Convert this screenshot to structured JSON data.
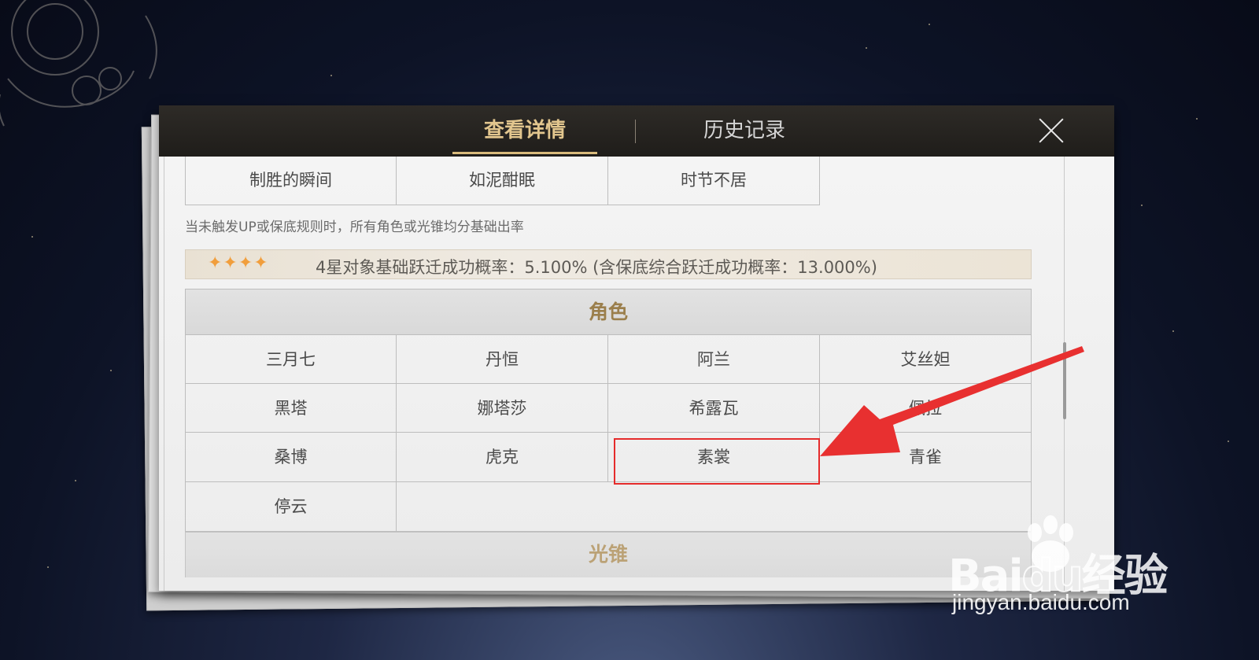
{
  "tabs": [
    {
      "label": "查看详情",
      "active": true
    },
    {
      "label": "历史记录",
      "active": false
    }
  ],
  "close_icon": "close-icon",
  "top_row": [
    "制胜的瞬间",
    "如泥酣眠",
    "时节不居"
  ],
  "note": "当未触发UP或保底规则时，所有角色或光锥均分基础出率",
  "rate": {
    "stars": "✦✦✦✦",
    "text": "4星对象基础跃迁成功概率：5.100% (含保底综合跃迁成功概率：13.000%)"
  },
  "characters_heading": "角色",
  "characters": [
    [
      "三月七",
      "丹恒",
      "阿兰",
      "艾丝妲"
    ],
    [
      "黑塔",
      "娜塔莎",
      "希露瓦",
      "佩拉"
    ],
    [
      "桑博",
      "虎克",
      "素裳",
      "青雀"
    ],
    [
      "停云"
    ]
  ],
  "light_cone_heading": "光锥",
  "annotation": {
    "highlighted": "素裳",
    "color": "#e52b2b"
  },
  "watermark": {
    "logo": "Bai",
    "logo_suffix": "du",
    "brand": "经验",
    "url": "jingyan.baidu.com"
  },
  "colors": {
    "accent": "#e2c68e",
    "star": "#f19e3c",
    "heading": "#9b7f4c"
  }
}
